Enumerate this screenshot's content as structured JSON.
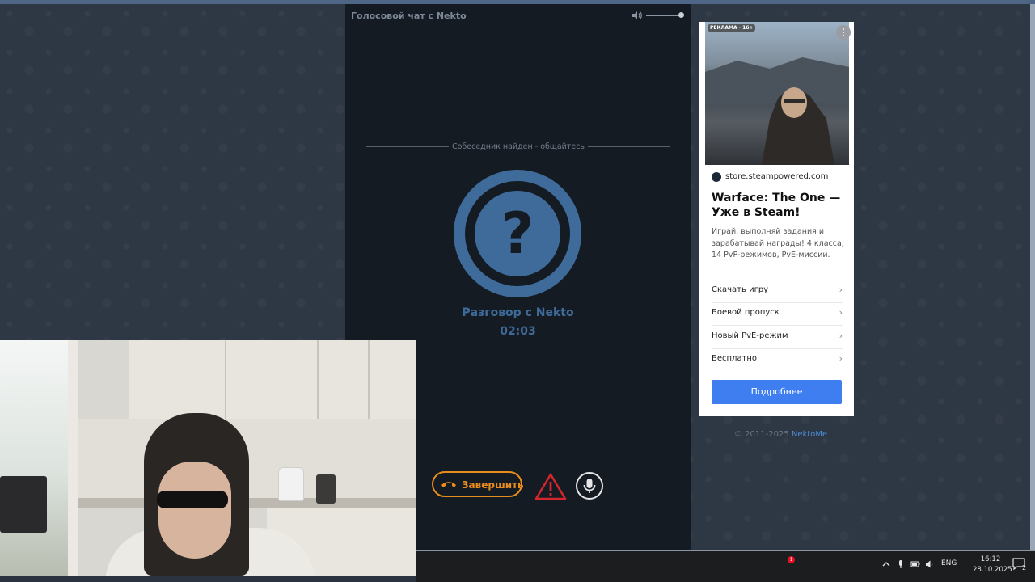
{
  "chat": {
    "title": "Голосовой чат с Nekto",
    "status_text": "Собеседник найден - общайтесь",
    "avatar_symbol": "?",
    "partner_label": "Разговор с Nekto",
    "timer": "02:03",
    "volume_level": 1.0,
    "end_button_label": "Завершить",
    "accent_color": "#e88c1d",
    "avatar_color": "#3f6b9a"
  },
  "ad": {
    "badge": "РЕКЛАМА · 16+",
    "domain": "store.steampowered.com",
    "title": "Warface: The One — Уже в Steam!",
    "description": "Играй, выполняй задания и зарабатывай награды! 4 класса, 14 PvP-режимов, PvE-миссии.",
    "links": [
      {
        "label": "Скачать игру",
        "chevron": "›"
      },
      {
        "label": "Боевой пропуск",
        "chevron": "›"
      },
      {
        "label": "Новый PvE-режим",
        "chevron": "›"
      },
      {
        "label": "Бесплатно",
        "chevron": "›"
      }
    ],
    "cta_label": "Подробнее",
    "cta_color": "#3e7ef0"
  },
  "footer": {
    "copyright": "© 2011-2025",
    "brand_link": "NektoMe"
  },
  "taskbar": {
    "alert_count": "1",
    "language": "ENG",
    "time": "16:12",
    "date": "28.10.2025",
    "notifications_count": "2"
  }
}
